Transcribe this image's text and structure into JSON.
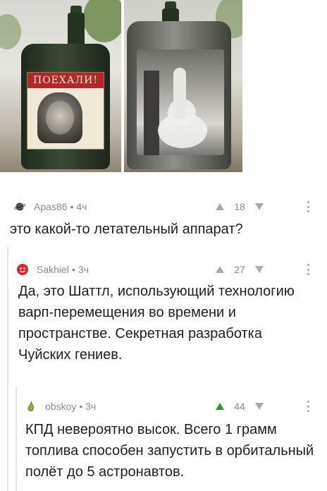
{
  "post": {
    "photo_label": "ПОЕХАЛИ!"
  },
  "comments": [
    {
      "author": "Apas86",
      "time": "4ч",
      "score": "18",
      "text": "это какой-то летательный аппарат?",
      "avatar_icon": "planet-icon",
      "upvoted": false
    },
    {
      "author": "Sakhiel",
      "time": "3ч",
      "score": "27",
      "text": "Да, это Шаттл, использующий технологию варп-перемещения во времени и пространстве. Секретная разработка Чуйских гениев.",
      "avatar_icon": "red-smiley-icon",
      "upvoted": false
    },
    {
      "author": "obskoy",
      "time": "3ч",
      "score": "44",
      "text": "КПД невероятно высок. Всего 1 грамм топлива способен запустить в орбитальный полёт до 5 астронавтов.",
      "avatar_icon": "pear-icon",
      "upvoted": true
    }
  ],
  "separator": "•",
  "colors": {
    "upvote_active": "#2e9a3c",
    "meta_text": "#8a8a8a",
    "thread_line": "#e5e5e5"
  }
}
